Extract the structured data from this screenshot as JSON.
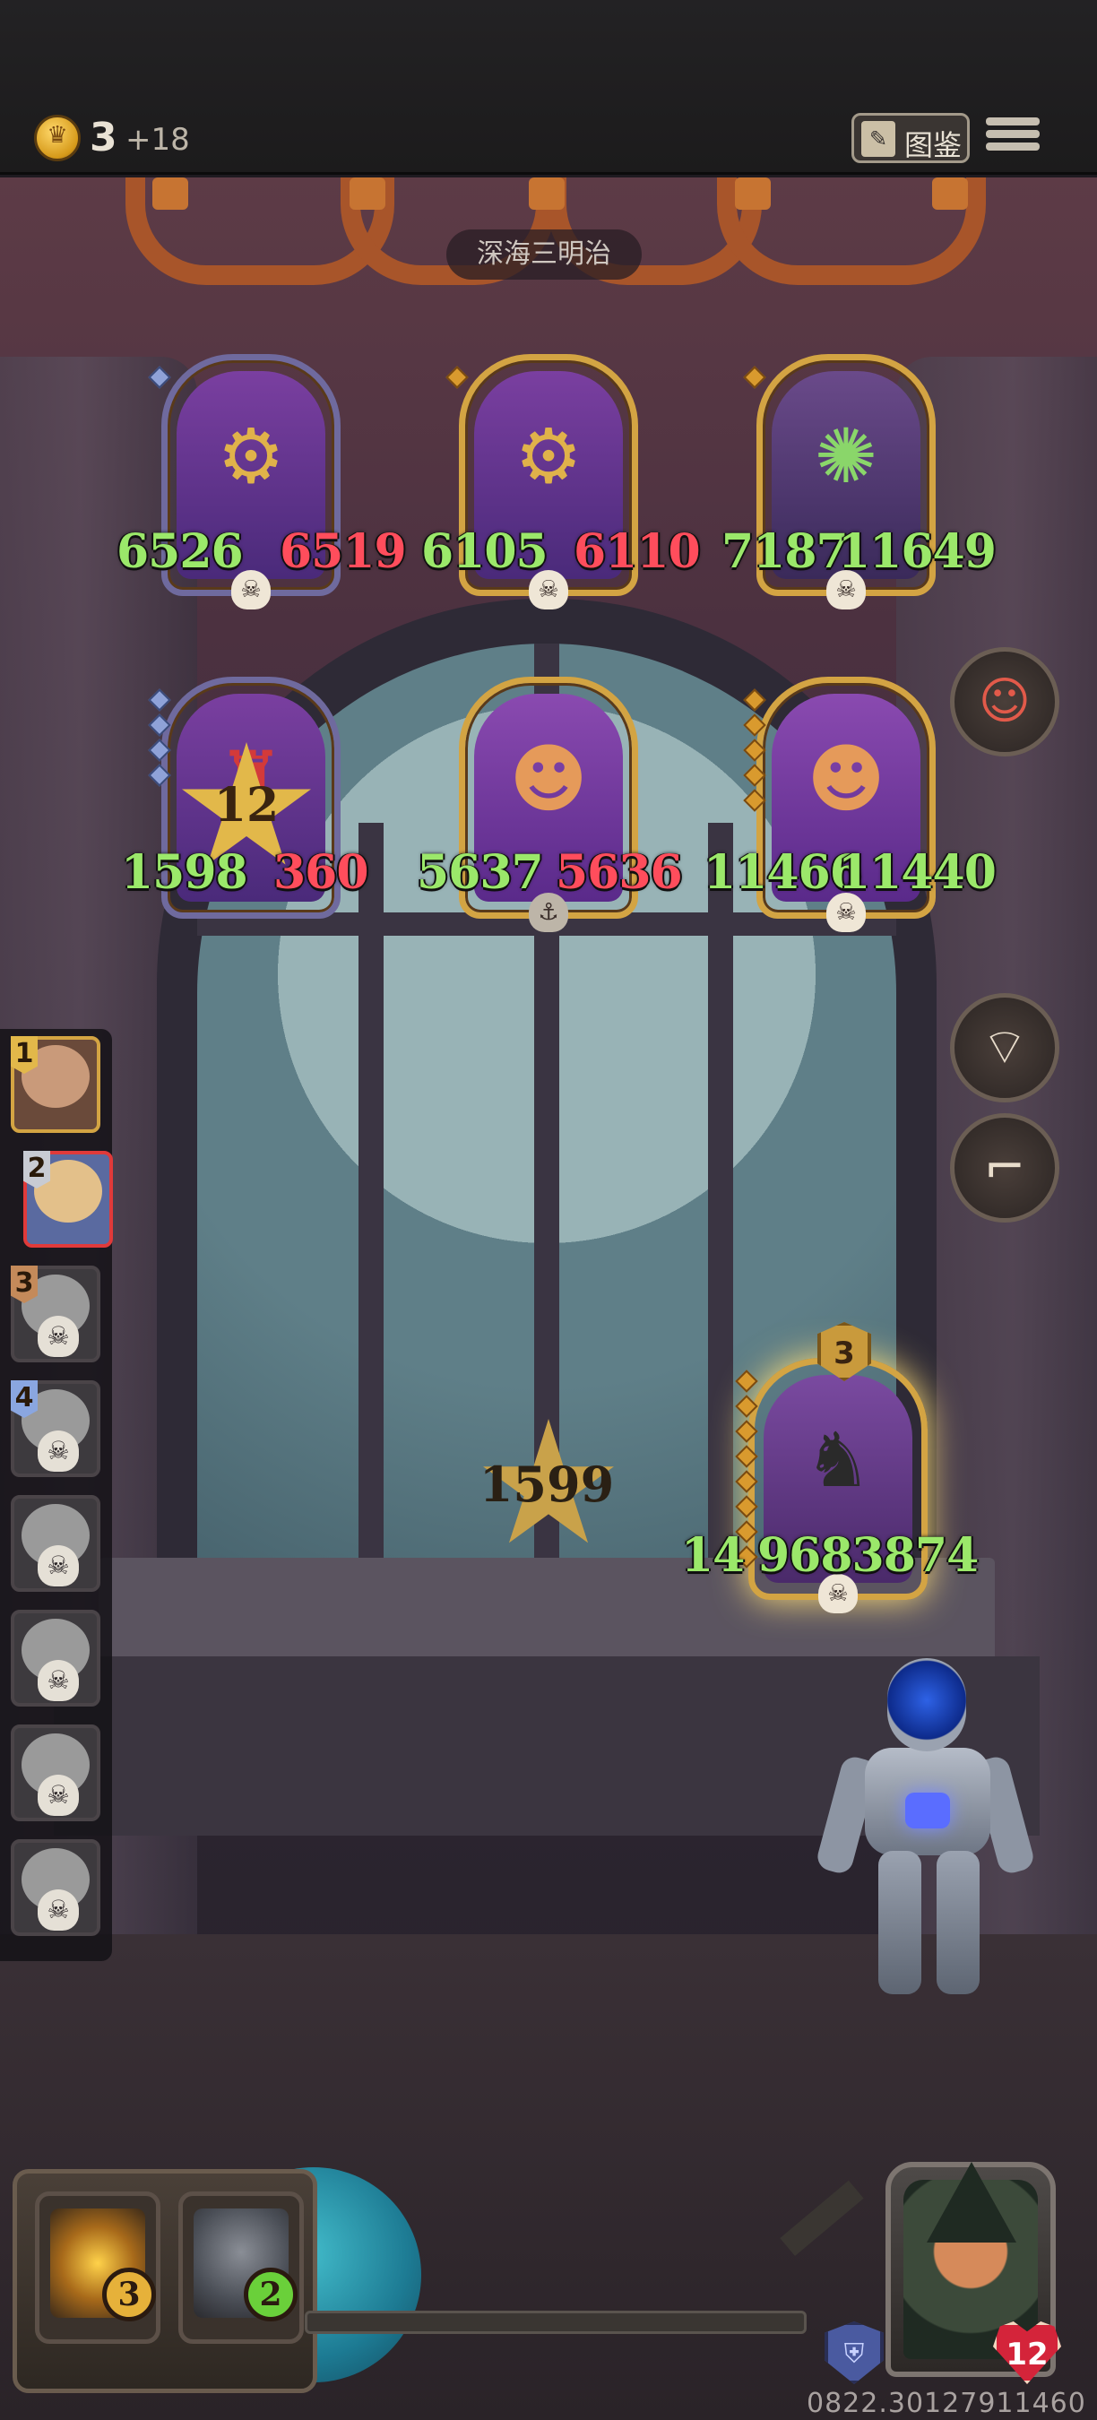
{
  "topbar": {
    "gold": "3",
    "gold_income": "+18",
    "codex_label": "图鉴"
  },
  "zone_name": "深海三明治",
  "enemy_board": [
    {
      "attack": "6526",
      "health": "6519"
    },
    {
      "attack": "6105",
      "health": "6110"
    },
    {
      "attack": "7187",
      "health": "11649"
    },
    {
      "attack": "1598",
      "health": "360",
      "badge": "12"
    },
    {
      "attack": "5637",
      "health": "5636"
    },
    {
      "attack": "11466",
      "health": "11440"
    }
  ],
  "center_star_value": "1599",
  "player_minion": {
    "tier": "3",
    "attack": "14",
    "health": "9683874"
  },
  "roster": [
    {
      "rank": "1"
    },
    {
      "rank": "2"
    },
    {
      "rank": "3"
    },
    {
      "rank": "4"
    }
  ],
  "shop": {
    "item1_cost": "3",
    "item2_cost": "2"
  },
  "hero": {
    "health": "12"
  },
  "build_id": "0822.30127911460",
  "colors": {
    "attack": "#9be86a",
    "health": "#ff4d5c",
    "gold_frame": "#d3a443",
    "active_slot": "#e03a3a"
  },
  "icons": [
    "coin-icon",
    "codex-icon",
    "menu-icon",
    "skull-icon",
    "mask-icon",
    "fan-icon",
    "rifle-icon",
    "shield-icon",
    "heart-icon"
  ]
}
